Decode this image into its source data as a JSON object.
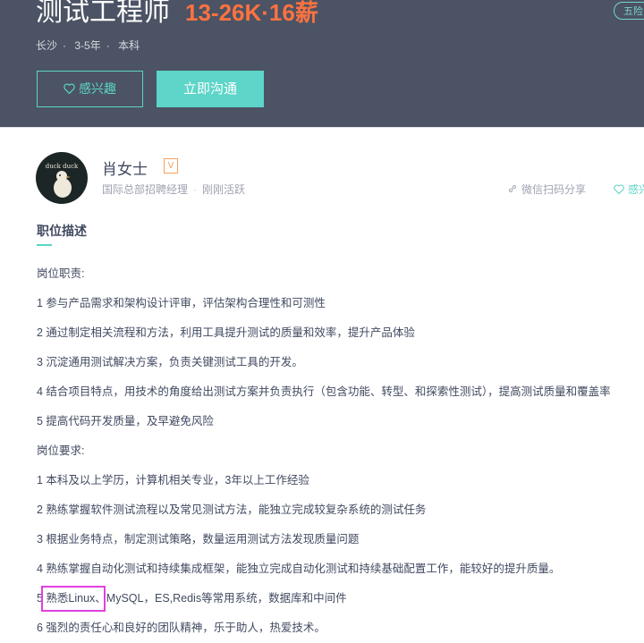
{
  "header": {
    "job_title": "测试工程师",
    "salary": "13-26K·16薪",
    "top_tag": "五险",
    "meta": [
      "长沙",
      "3-5年",
      "本科"
    ],
    "separator": "·",
    "interest_button": "感兴趣",
    "chat_button": "立即沟通"
  },
  "recruiter": {
    "avatar_text": "duck duck",
    "name": "肖女士",
    "verify_badge": "V",
    "position": "国际总部招聘经理",
    "separator": "·",
    "status": "刚刚活跃",
    "share_label": "微信扫码分享",
    "interest_label": "感兴"
  },
  "description": {
    "title": "职位描述",
    "lines": [
      "岗位职责:",
      "1 参与产品需求和架构设计评审，评估架构合理性和可测性",
      "2 通过制定相关流程和方法，利用工具提升测试的质量和效率，提升产品体验",
      "3 沉淀通用测试解决方案，负责关键测试工具的开发。",
      "4 结合项目特点，用技术的角度给出测试方案并负责执行（包含功能、转型、和探索性测试），提高测试质量和覆盖率",
      "5 提高代码开发质量，及早避免风险",
      "岗位要求:",
      "1 本科及以上学历，计算机相关专业，3年以上工作经验",
      "2 熟练掌握软件测试流程以及常见测试方法，能独立完成较复杂系统的测试任务",
      "3 根据业务特点，制定测试策略，数量运用测试方法发现质量问题",
      "4 熟练掌握自动化测试和持续集成框架，能独立完成自动化测试和持续基础配置工作，能较好的提升质量。",
      "5 熟悉Linux、MySQL，ES,Redis等常用系统，数据库和中间件",
      "6 强烈的责任心和良好的团队精神，乐于助人，热爱技术。"
    ]
  },
  "colors": {
    "header_bg": "#4b5364",
    "accent": "#5dd5c8",
    "salary": "#fd7240",
    "highlight": "#e040e0"
  }
}
